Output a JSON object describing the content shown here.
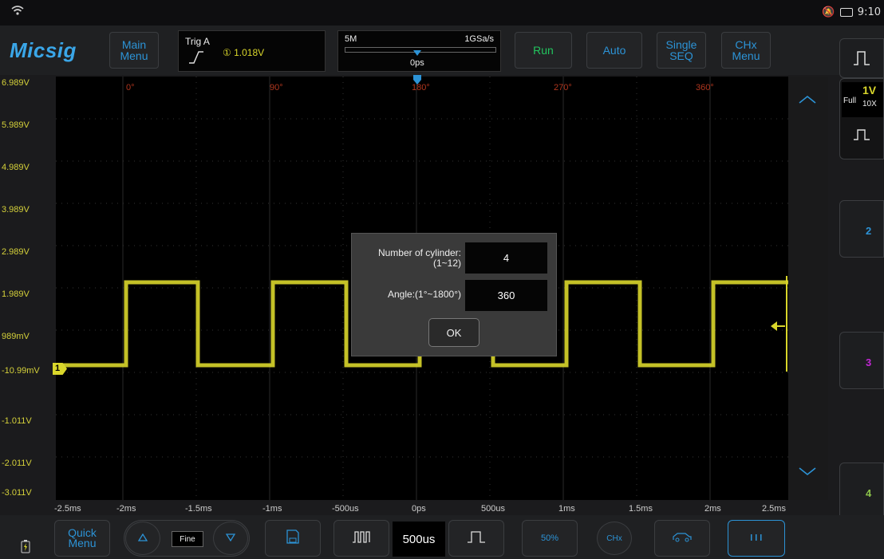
{
  "status": {
    "time": "9:10"
  },
  "brand": "Micsig",
  "toolbar": {
    "main_menu": "Main\nMenu",
    "trig_label": "Trig A",
    "trig_level": "① 1.018V",
    "memory_depth": "5M",
    "sample_rate": "1GSa/s",
    "trigger_position": "0ps",
    "run": "Run",
    "auto": "Auto",
    "single_seq": "Single\nSEQ",
    "chx_menu": "CHx\nMenu"
  },
  "y_axis_labels": [
    "6.989V",
    "5.989V",
    "4.989V",
    "3.989V",
    "2.989V",
    "1.989V",
    "989mV",
    "-10.99mV",
    "-1.011V",
    "-2.011V",
    "-3.011V"
  ],
  "x_axis_labels": [
    "-2.5ms",
    "-2ms",
    "-1.5ms",
    "-1ms",
    "-500us",
    "0ps",
    "500us",
    "1ms",
    "1.5ms",
    "2ms",
    "2.5ms"
  ],
  "phase_labels": [
    "0°",
    "90°",
    "180°",
    "270°",
    "360°"
  ],
  "channel_marker": "1",
  "right_panel": {
    "ch1_scale": "1V",
    "ch1_bw": "Full",
    "ch1_probe": "10X",
    "ch2": "2",
    "ch3": "3",
    "ch4": "4"
  },
  "dialog": {
    "cylinder_label": "Number of cylinder:\n(1~12)",
    "cylinder_value": "4",
    "angle_label": "Angle:(1°~1800°)",
    "angle_value": "360",
    "ok": "OK"
  },
  "bottom": {
    "quick_menu": "Quick\nMenu",
    "fine": "Fine",
    "timebase": "500us",
    "fifty": "50%",
    "chx": "CHx"
  },
  "colors": {
    "ch1": "#d9d62b",
    "accent": "#2c93d6",
    "ch3": "#c026d3",
    "ch4": "#8bc34a",
    "ch2": "#2c93d6"
  }
}
